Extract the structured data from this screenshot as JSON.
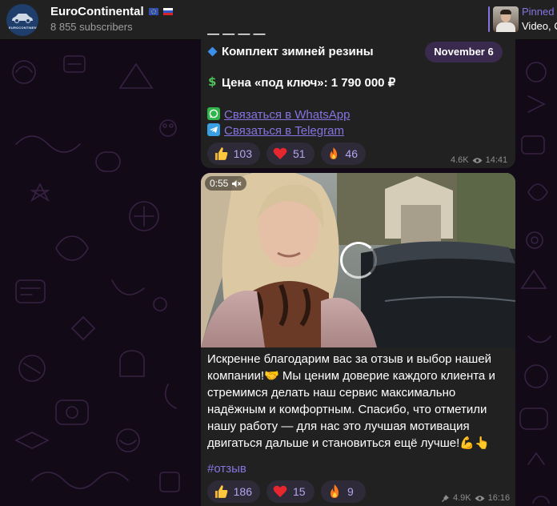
{
  "header": {
    "channel_name": "EuroContinental",
    "subscribers": "8 855 subscribers",
    "avatar_text": "EUROCONTINENTAL",
    "pinned_label": "Pinned",
    "pinned_preview": "Video, C"
  },
  "messages": [
    {
      "cut_text": "— — — —",
      "item_line": "Комплект зимней резины",
      "price_label": "Цена «под ключ»:",
      "price_value": "1 790 000 ₽",
      "links": [
        "Связаться в WhatsApp",
        "Связаться в Telegram"
      ],
      "reactions": [
        {
          "emoji": "thumbs-up",
          "count": "103"
        },
        {
          "emoji": "heart",
          "count": "51"
        },
        {
          "emoji": "fire",
          "count": "46"
        }
      ],
      "views": "4.6K",
      "time": "14:41"
    },
    {
      "video_duration": "0:55",
      "caption_lines": [
        "Искренне благодарим вас за отзыв и выбор нашей",
        "компании!🤝 Мы ценим доверие каждого клиента и",
        "стремимся делать наш сервис максимально",
        "надёжным и комфортным. Спасибо, что отметили",
        "нашу работу — для нас это лучшая мотивация",
        "двигаться дальше и становиться ещё лучше!💪👆"
      ],
      "hashtag": "#отзыв",
      "reactions": [
        {
          "emoji": "thumbs-up",
          "count": "186"
        },
        {
          "emoji": "heart",
          "count": "15"
        },
        {
          "emoji": "fire",
          "count": "9"
        }
      ],
      "views": "4.9K",
      "time": "16:16"
    }
  ],
  "date_separator": "November 6",
  "colors": {
    "background": "#120a17",
    "bubble": "#212121",
    "accent": "#8774e1",
    "date_pill": "#3a2a4d"
  }
}
